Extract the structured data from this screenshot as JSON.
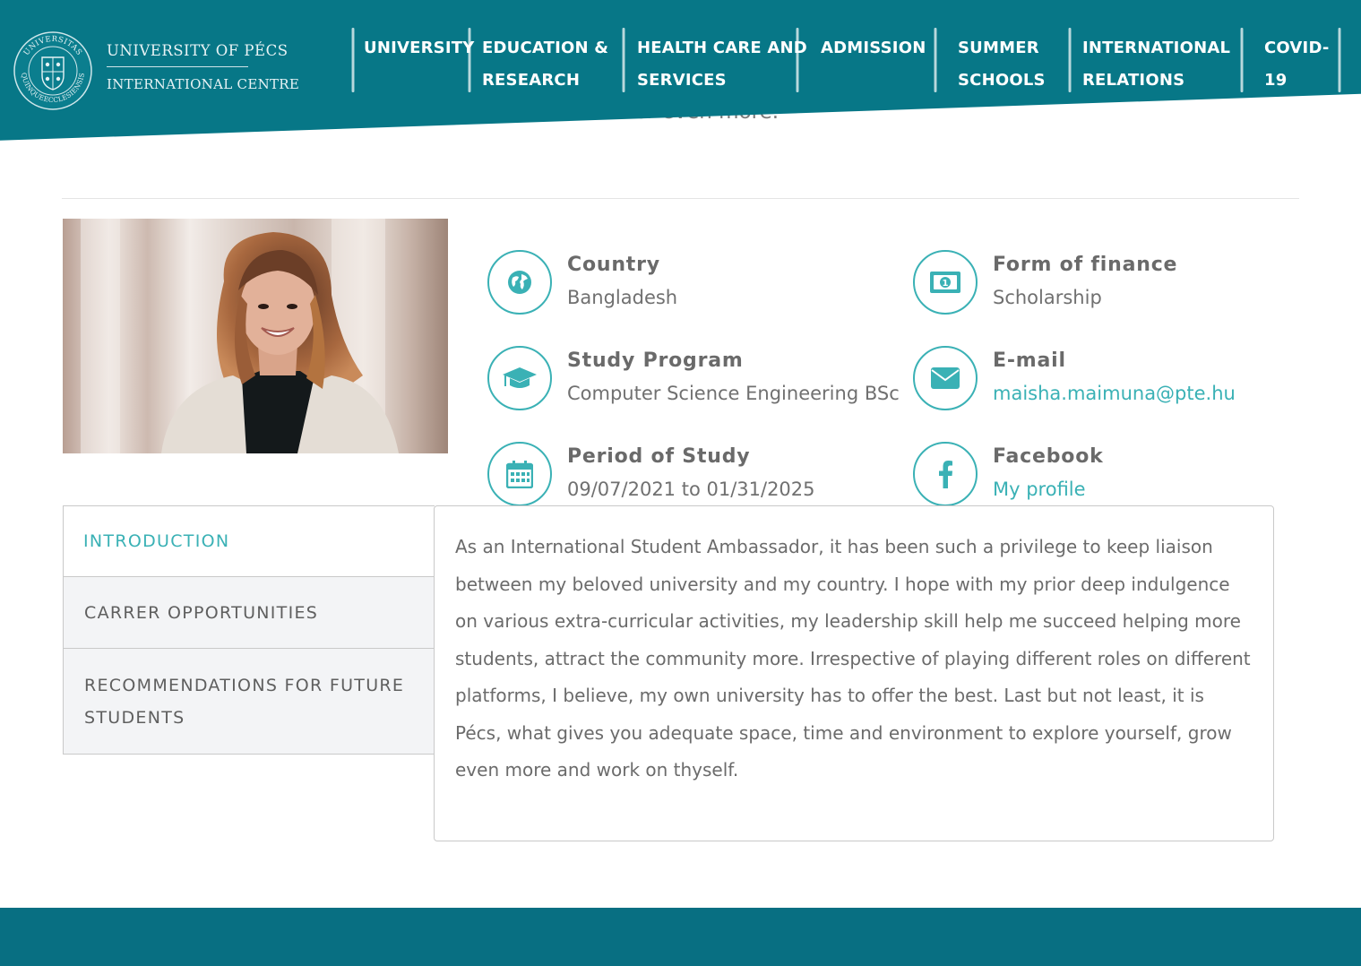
{
  "header": {
    "brand_line1": "UNIVERSITY OF PÉCS",
    "brand_line2": "INTERNATIONAL CENTRE",
    "logo_text": "UNIVERSITAS QUINQUEECCLESIENSIS",
    "nav": [
      {
        "line1": "UNIVERSITY",
        "line2": ""
      },
      {
        "line1": "EDUCATION &",
        "line2": "RESEARCH"
      },
      {
        "line1": "HEALTH CARE AND",
        "line2": "SERVICES"
      },
      {
        "line1": "ADMISSION",
        "line2": ""
      },
      {
        "line1": "SUMMER",
        "line2": "SCHOOLS"
      },
      {
        "line1": "INTERNATIONAL",
        "line2": "RELATIONS"
      },
      {
        "line1": "COVID-",
        "line2": "19"
      }
    ]
  },
  "peek_text": "y future career even more.",
  "profile": {
    "photo_icon": "student-portrait-photo",
    "country": {
      "label": "Country",
      "value": "Bangladesh",
      "icon": "globe-icon"
    },
    "finance": {
      "label": "Form of finance",
      "value": "Scholarship",
      "icon": "money-icon"
    },
    "program": {
      "label": "Study Program",
      "value": "Computer Science Engineering BSc",
      "icon": "graduation-cap-icon"
    },
    "email": {
      "label": "E-mail",
      "value": "maisha.maimuna@pte.hu",
      "icon": "envelope-icon"
    },
    "period": {
      "label": "Period of Study",
      "value": "09/07/2021 to 01/31/2025",
      "icon": "calendar-icon"
    },
    "facebook": {
      "label": "Facebook",
      "value": "My profile",
      "icon": "facebook-icon"
    }
  },
  "tabs": [
    {
      "label": "INTRODUCTION",
      "active": true
    },
    {
      "label": "CARRER OPPORTUNITIES",
      "active": false
    },
    {
      "label": "RECOMMENDATIONS FOR FUTURE STUDENTS",
      "active": false
    }
  ],
  "content": {
    "text": "As an International Student Ambassador, it has been such a privilege to keep liaison between my beloved university and my country. I hope with my prior deep indulgence on various extra-curricular activities, my leadership skill help me succeed helping more students, attract the community more. Irrespective of playing different roles on different platforms, I believe, my own university has to offer the best. Last but not least, it is Pécs, what gives you adequate space, time and environment to explore yourself, grow even more and work on thyself."
  },
  "colors": {
    "brand": "#077787",
    "accent": "#3ab1b5",
    "footer": "#086f82"
  }
}
